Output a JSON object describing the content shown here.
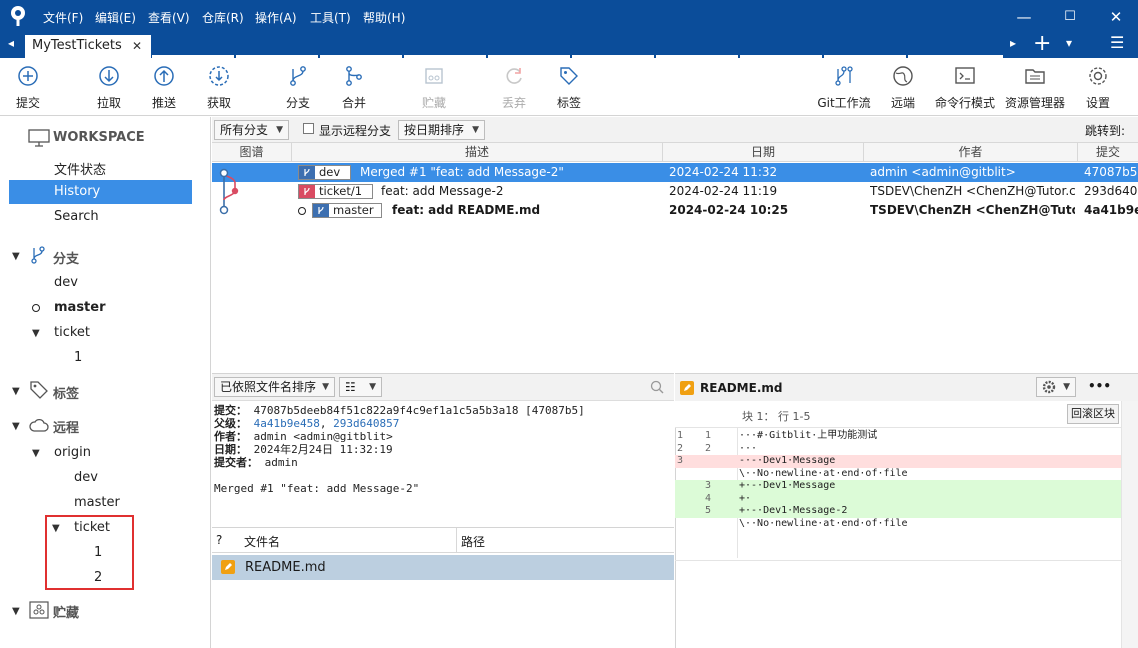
{
  "titlebar": {
    "menus": [
      "文件(F)",
      "编辑(E)",
      "查看(V)",
      "仓库(R)",
      "操作(A)",
      "工具(T)",
      "帮助(H)"
    ],
    "minimize": "—",
    "maximize": "☐",
    "close": "✕"
  },
  "tabs": {
    "active_label": "MyTestTickets",
    "close_glyph": "✕",
    "left_arrow": "◂",
    "right_arrow": "▸",
    "add": "+",
    "dropdown": "▾",
    "menu": "☰"
  },
  "toolbar": {
    "commit": "提交",
    "pull": "拉取",
    "push": "推送",
    "fetch": "获取",
    "branch": "分支",
    "merge": "合并",
    "stash": "贮藏",
    "discard": "丢弃",
    "tag": "标签",
    "gitflow": "Git工作流",
    "remote": "远端",
    "terminal": "命令行模式",
    "explorer": "资源管理器",
    "settings": "设置"
  },
  "sidebar": {
    "workspace": "WORKSPACE",
    "file_status": "文件状态",
    "history": "History",
    "search": "Search",
    "branches": "分支",
    "branch_dev": "dev",
    "branch_master": "master",
    "branch_ticket": "ticket",
    "branch_ticket_1": "1",
    "tags": "标签",
    "remotes": "远程",
    "origin": "origin",
    "origin_dev": "dev",
    "origin_master": "master",
    "origin_ticket": "ticket",
    "origin_ticket_1": "1",
    "origin_ticket_2": "2",
    "stashes": "贮藏"
  },
  "filterbar": {
    "all_branches": "所有分支",
    "show_remote": "显示远程分支",
    "sort_by_date": "按日期排序",
    "jump_to": "跳转到:"
  },
  "log": {
    "headers": {
      "graph": "图谱",
      "desc": "描述",
      "date": "日期",
      "author": "作者",
      "commit": "提交"
    },
    "rows": [
      {
        "ref": "dev",
        "desc": "Merged #1 \"feat: add Message-2\"",
        "date": "2024-02-24 11:32",
        "author": "admin <admin@gitblit>",
        "commit": "47087b5"
      },
      {
        "ref": "ticket/1",
        "desc": "feat: add Message-2",
        "date": "2024-02-24 11:19",
        "author": "TSDEV\\ChenZH <ChenZH@Tutor.co",
        "commit": "293d640"
      },
      {
        "ref": "master",
        "desc": "feat: add README.md",
        "date": "2024-02-24 10:25",
        "author": "TSDEV\\ChenZH <ChenZH@Tutor",
        "commit": "4a41b9e"
      }
    ]
  },
  "info": {
    "sort_label": "已依照文件名排序",
    "view_label": "☷",
    "commit_label": "提交：",
    "commit_hash": "47087b5deeb84f51c822a9f4c9ef1a1c5a5b3a18 [47087b5]",
    "parents_label": "父级：",
    "parent1": "4a41b9e458",
    "parents_sep": ", ",
    "parent2": "293d640857",
    "author_label": "作者：",
    "author": "admin <admin@gitblit>",
    "date_label": "日期：",
    "date": "2024年2月24日 11:32:19",
    "committer_label": "提交者：",
    "committer": "admin",
    "message": "Merged #1 \"feat: add Message-2\""
  },
  "files": {
    "col_status": "?",
    "col_name": "文件名",
    "col_path": "路径",
    "file_name": "README.md"
  },
  "diff": {
    "file": "README.md",
    "hunk": "块 1： 行 1-5",
    "revert_hunk": "回滚区块",
    "more": "•••",
    "lines": [
      {
        "n1": "1",
        "n2": "1",
        "kind": "ctx",
        "text": "···#·Gitblit·上甲功能测试"
      },
      {
        "n1": "2",
        "n2": "2",
        "kind": "ctx",
        "text": "···"
      },
      {
        "n1": "3",
        "n2": "",
        "kind": "del",
        "text": "-·-·Dev1·Message"
      },
      {
        "n1": "",
        "n2": "",
        "kind": "ctx",
        "text": "\\··No·newline·at·end·of·file"
      },
      {
        "n1": "",
        "n2": "3",
        "kind": "add",
        "text": "+·-·Dev1·Message"
      },
      {
        "n1": "",
        "n2": "4",
        "kind": "add",
        "text": "+·"
      },
      {
        "n1": "",
        "n2": "5",
        "kind": "add",
        "text": "+·-·Dev1·Message-2"
      },
      {
        "n1": "",
        "n2": "",
        "kind": "ctx",
        "text": "\\··No·newline·at·end·of·file"
      }
    ]
  },
  "colors": {
    "titlebar": "#0b4d9a",
    "selection": "#3a8ee6",
    "file_selection": "#bccfe0",
    "highlight_box": "#e03030"
  }
}
